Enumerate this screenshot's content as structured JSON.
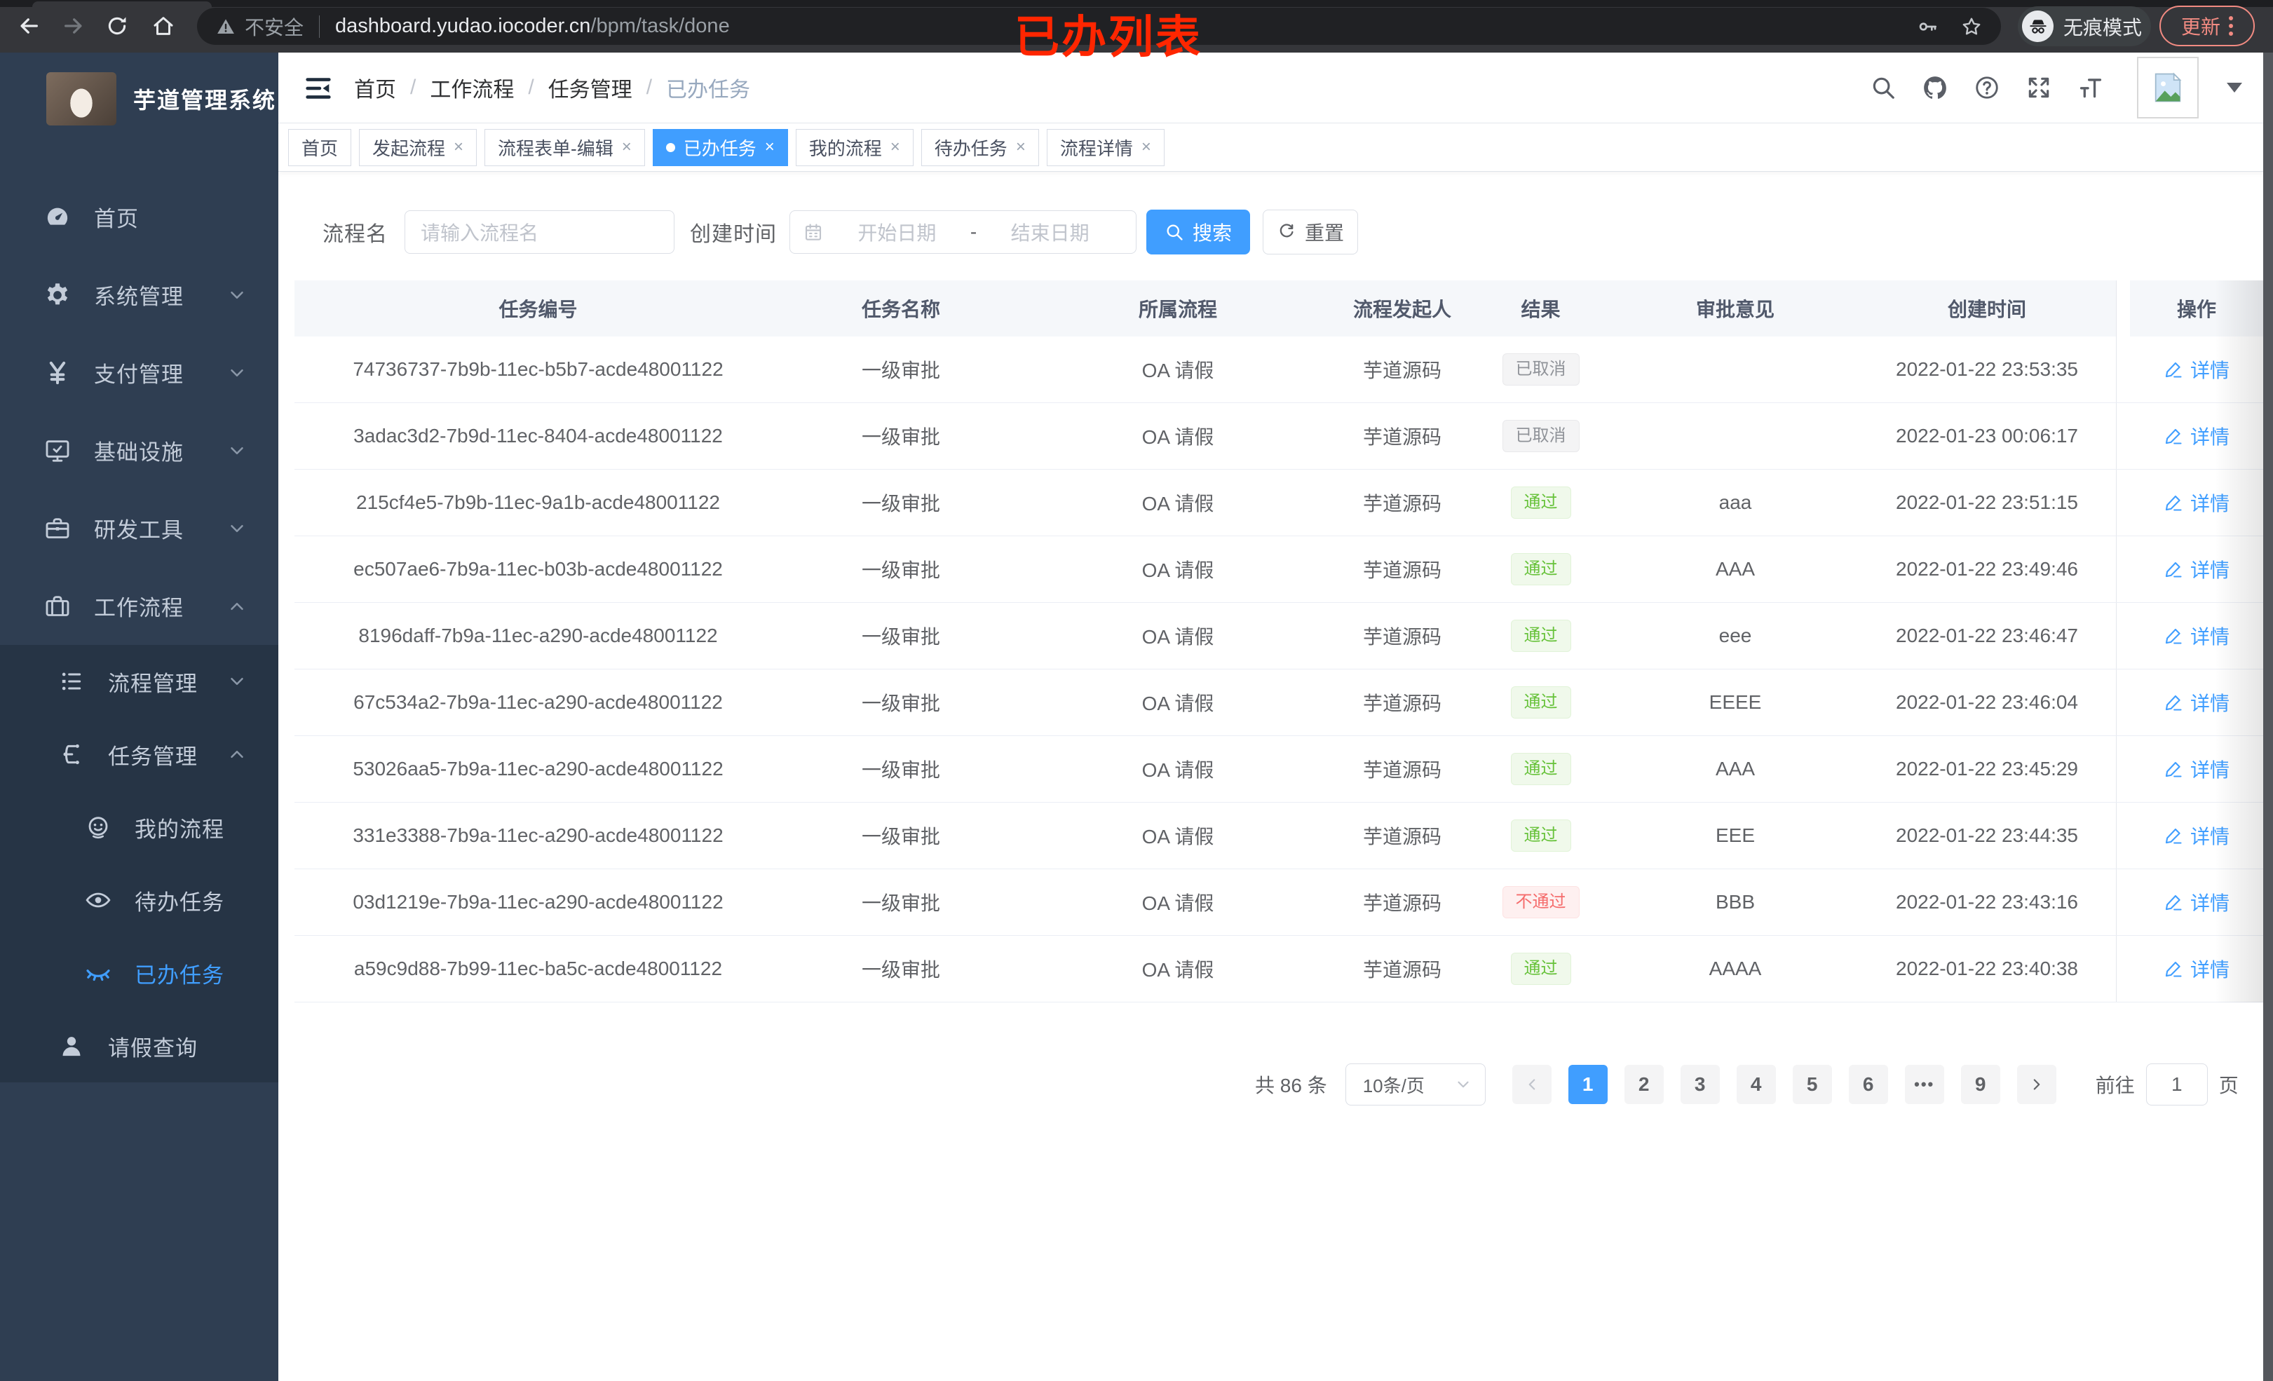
{
  "browser": {
    "security_warning": "不安全",
    "url_host": "dashboard.yudao.iocoder.cn",
    "url_path": "/bpm/task/done",
    "incognito_label": "无痕模式",
    "update_label": "更新",
    "annotation": "已办列表"
  },
  "icons": {
    "browser": [
      "back-arrow",
      "forward-arrow",
      "reload",
      "home",
      "warning-triangle",
      "key",
      "star",
      "incognito",
      "menu-dots"
    ],
    "header": [
      "search",
      "github",
      "question-circle",
      "fullscreen",
      "font-size",
      "image-placeholder",
      "caret-down"
    ]
  },
  "sidebar": {
    "title": "芋道管理系统",
    "menu": [
      {
        "label": "首页",
        "icon": "gauge",
        "level": "1",
        "arrow": "",
        "state": ""
      },
      {
        "label": "系统管理",
        "icon": "gear",
        "level": "1",
        "arrow": "down",
        "state": ""
      },
      {
        "label": "支付管理",
        "icon": "yen",
        "level": "1",
        "arrow": "down",
        "state": ""
      },
      {
        "label": "基础设施",
        "icon": "monitor",
        "level": "1",
        "arrow": "down",
        "state": ""
      },
      {
        "label": "研发工具",
        "icon": "toolbox",
        "level": "1",
        "arrow": "down",
        "state": ""
      },
      {
        "label": "工作流程",
        "icon": "suitcase",
        "level": "1",
        "arrow": "up",
        "state": ""
      }
    ],
    "submenu": [
      {
        "label": "流程管理",
        "icon": "tree",
        "level": "2",
        "arrow": "down",
        "state": ""
      },
      {
        "label": "任务管理",
        "icon": "flow",
        "level": "2",
        "arrow": "up",
        "state": ""
      },
      {
        "label": "我的流程",
        "icon": "face",
        "level": "3",
        "arrow": "",
        "state": ""
      },
      {
        "label": "待办任务",
        "icon": "eye",
        "level": "3",
        "arrow": "",
        "state": ""
      },
      {
        "label": "已办任务",
        "icon": "eye-closed",
        "level": "3",
        "arrow": "",
        "state": "active"
      },
      {
        "label": "请假查询",
        "icon": "user",
        "level": "2",
        "arrow": "",
        "state": ""
      }
    ]
  },
  "header": {
    "breadcrumb": [
      {
        "label": "首页",
        "sep": ""
      },
      {
        "label": "工作流程",
        "sep": "/"
      },
      {
        "label": "任务管理",
        "sep": "/"
      },
      {
        "label": "已办任务",
        "sep": "/",
        "state": "last"
      }
    ]
  },
  "tabs": [
    {
      "label": "首页",
      "closable": false,
      "active": false,
      "state": ""
    },
    {
      "label": "发起流程",
      "closable": true,
      "active": false,
      "state": ""
    },
    {
      "label": "流程表单-编辑",
      "closable": true,
      "active": false,
      "state": ""
    },
    {
      "label": "已办任务",
      "closable": true,
      "active": true,
      "state": "active"
    },
    {
      "label": "我的流程",
      "closable": true,
      "active": false,
      "state": ""
    },
    {
      "label": "待办任务",
      "closable": true,
      "active": false,
      "state": ""
    },
    {
      "label": "流程详情",
      "closable": true,
      "active": false,
      "state": ""
    }
  ],
  "filters": {
    "name_label": "流程名",
    "name_placeholder": "请输入流程名",
    "time_label": "创建时间",
    "start_placeholder": "开始日期",
    "range_separator": "-",
    "end_placeholder": "结束日期",
    "search_label": "搜索",
    "reset_label": "重置"
  },
  "table": {
    "columns": [
      "任务编号",
      "任务名称",
      "所属流程",
      "流程发起人",
      "结果",
      "审批意见",
      "创建时间",
      "操作"
    ],
    "action_label": "详情",
    "rows": [
      {
        "id": "74736737-7b9b-11ec-b5b7-acde48001122",
        "name": "一级审批",
        "process": "OA 请假",
        "starter": "芋道源码",
        "result": "已取消",
        "result_type": "info",
        "opinion": "",
        "time": "2022-01-22 23:53:35"
      },
      {
        "id": "3adac3d2-7b9d-11ec-8404-acde48001122",
        "name": "一级审批",
        "process": "OA 请假",
        "starter": "芋道源码",
        "result": "已取消",
        "result_type": "info",
        "opinion": "",
        "time": "2022-01-23 00:06:17"
      },
      {
        "id": "215cf4e5-7b9b-11ec-9a1b-acde48001122",
        "name": "一级审批",
        "process": "OA 请假",
        "starter": "芋道源码",
        "result": "通过",
        "result_type": "success",
        "opinion": "aaa",
        "time": "2022-01-22 23:51:15"
      },
      {
        "id": "ec507ae6-7b9a-11ec-b03b-acde48001122",
        "name": "一级审批",
        "process": "OA 请假",
        "starter": "芋道源码",
        "result": "通过",
        "result_type": "success",
        "opinion": "AAA",
        "time": "2022-01-22 23:49:46"
      },
      {
        "id": "8196daff-7b9a-11ec-a290-acde48001122",
        "name": "一级审批",
        "process": "OA 请假",
        "starter": "芋道源码",
        "result": "通过",
        "result_type": "success",
        "opinion": "eee",
        "time": "2022-01-22 23:46:47"
      },
      {
        "id": "67c534a2-7b9a-11ec-a290-acde48001122",
        "name": "一级审批",
        "process": "OA 请假",
        "starter": "芋道源码",
        "result": "通过",
        "result_type": "success",
        "opinion": "EEEE",
        "time": "2022-01-22 23:46:04"
      },
      {
        "id": "53026aa5-7b9a-11ec-a290-acde48001122",
        "name": "一级审批",
        "process": "OA 请假",
        "starter": "芋道源码",
        "result": "通过",
        "result_type": "success",
        "opinion": "AAA",
        "time": "2022-01-22 23:45:29"
      },
      {
        "id": "331e3388-7b9a-11ec-a290-acde48001122",
        "name": "一级审批",
        "process": "OA 请假",
        "starter": "芋道源码",
        "result": "通过",
        "result_type": "success",
        "opinion": "EEE",
        "time": "2022-01-22 23:44:35"
      },
      {
        "id": "03d1219e-7b9a-11ec-a290-acde48001122",
        "name": "一级审批",
        "process": "OA 请假",
        "starter": "芋道源码",
        "result": "不通过",
        "result_type": "danger",
        "opinion": "BBB",
        "time": "2022-01-22 23:43:16"
      },
      {
        "id": "a59c9d88-7b99-11ec-ba5c-acde48001122",
        "name": "一级审批",
        "process": "OA 请假",
        "starter": "芋道源码",
        "result": "通过",
        "result_type": "success",
        "opinion": "AAAA",
        "time": "2022-01-22 23:40:38"
      }
    ]
  },
  "pagination": {
    "total": "共 86 条",
    "page_size": "10条/页",
    "pages": [
      {
        "label": "1",
        "state": "active"
      },
      {
        "label": "2",
        "state": ""
      },
      {
        "label": "3",
        "state": ""
      },
      {
        "label": "4",
        "state": ""
      },
      {
        "label": "5",
        "state": ""
      },
      {
        "label": "6",
        "state": ""
      },
      {
        "label": "•••",
        "state": "more"
      },
      {
        "label": "9",
        "state": ""
      }
    ],
    "goto_label": "前往",
    "goto_value": "1",
    "page_label": "页"
  },
  "colors": {
    "accent": "#409eff",
    "success": "#67c23a",
    "danger": "#f56c6c",
    "info": "#909399",
    "sidebar_bg": "#2f3e52",
    "submenu_bg": "#263445",
    "annotation": "#ff2600",
    "update_button": "#f28b82"
  }
}
